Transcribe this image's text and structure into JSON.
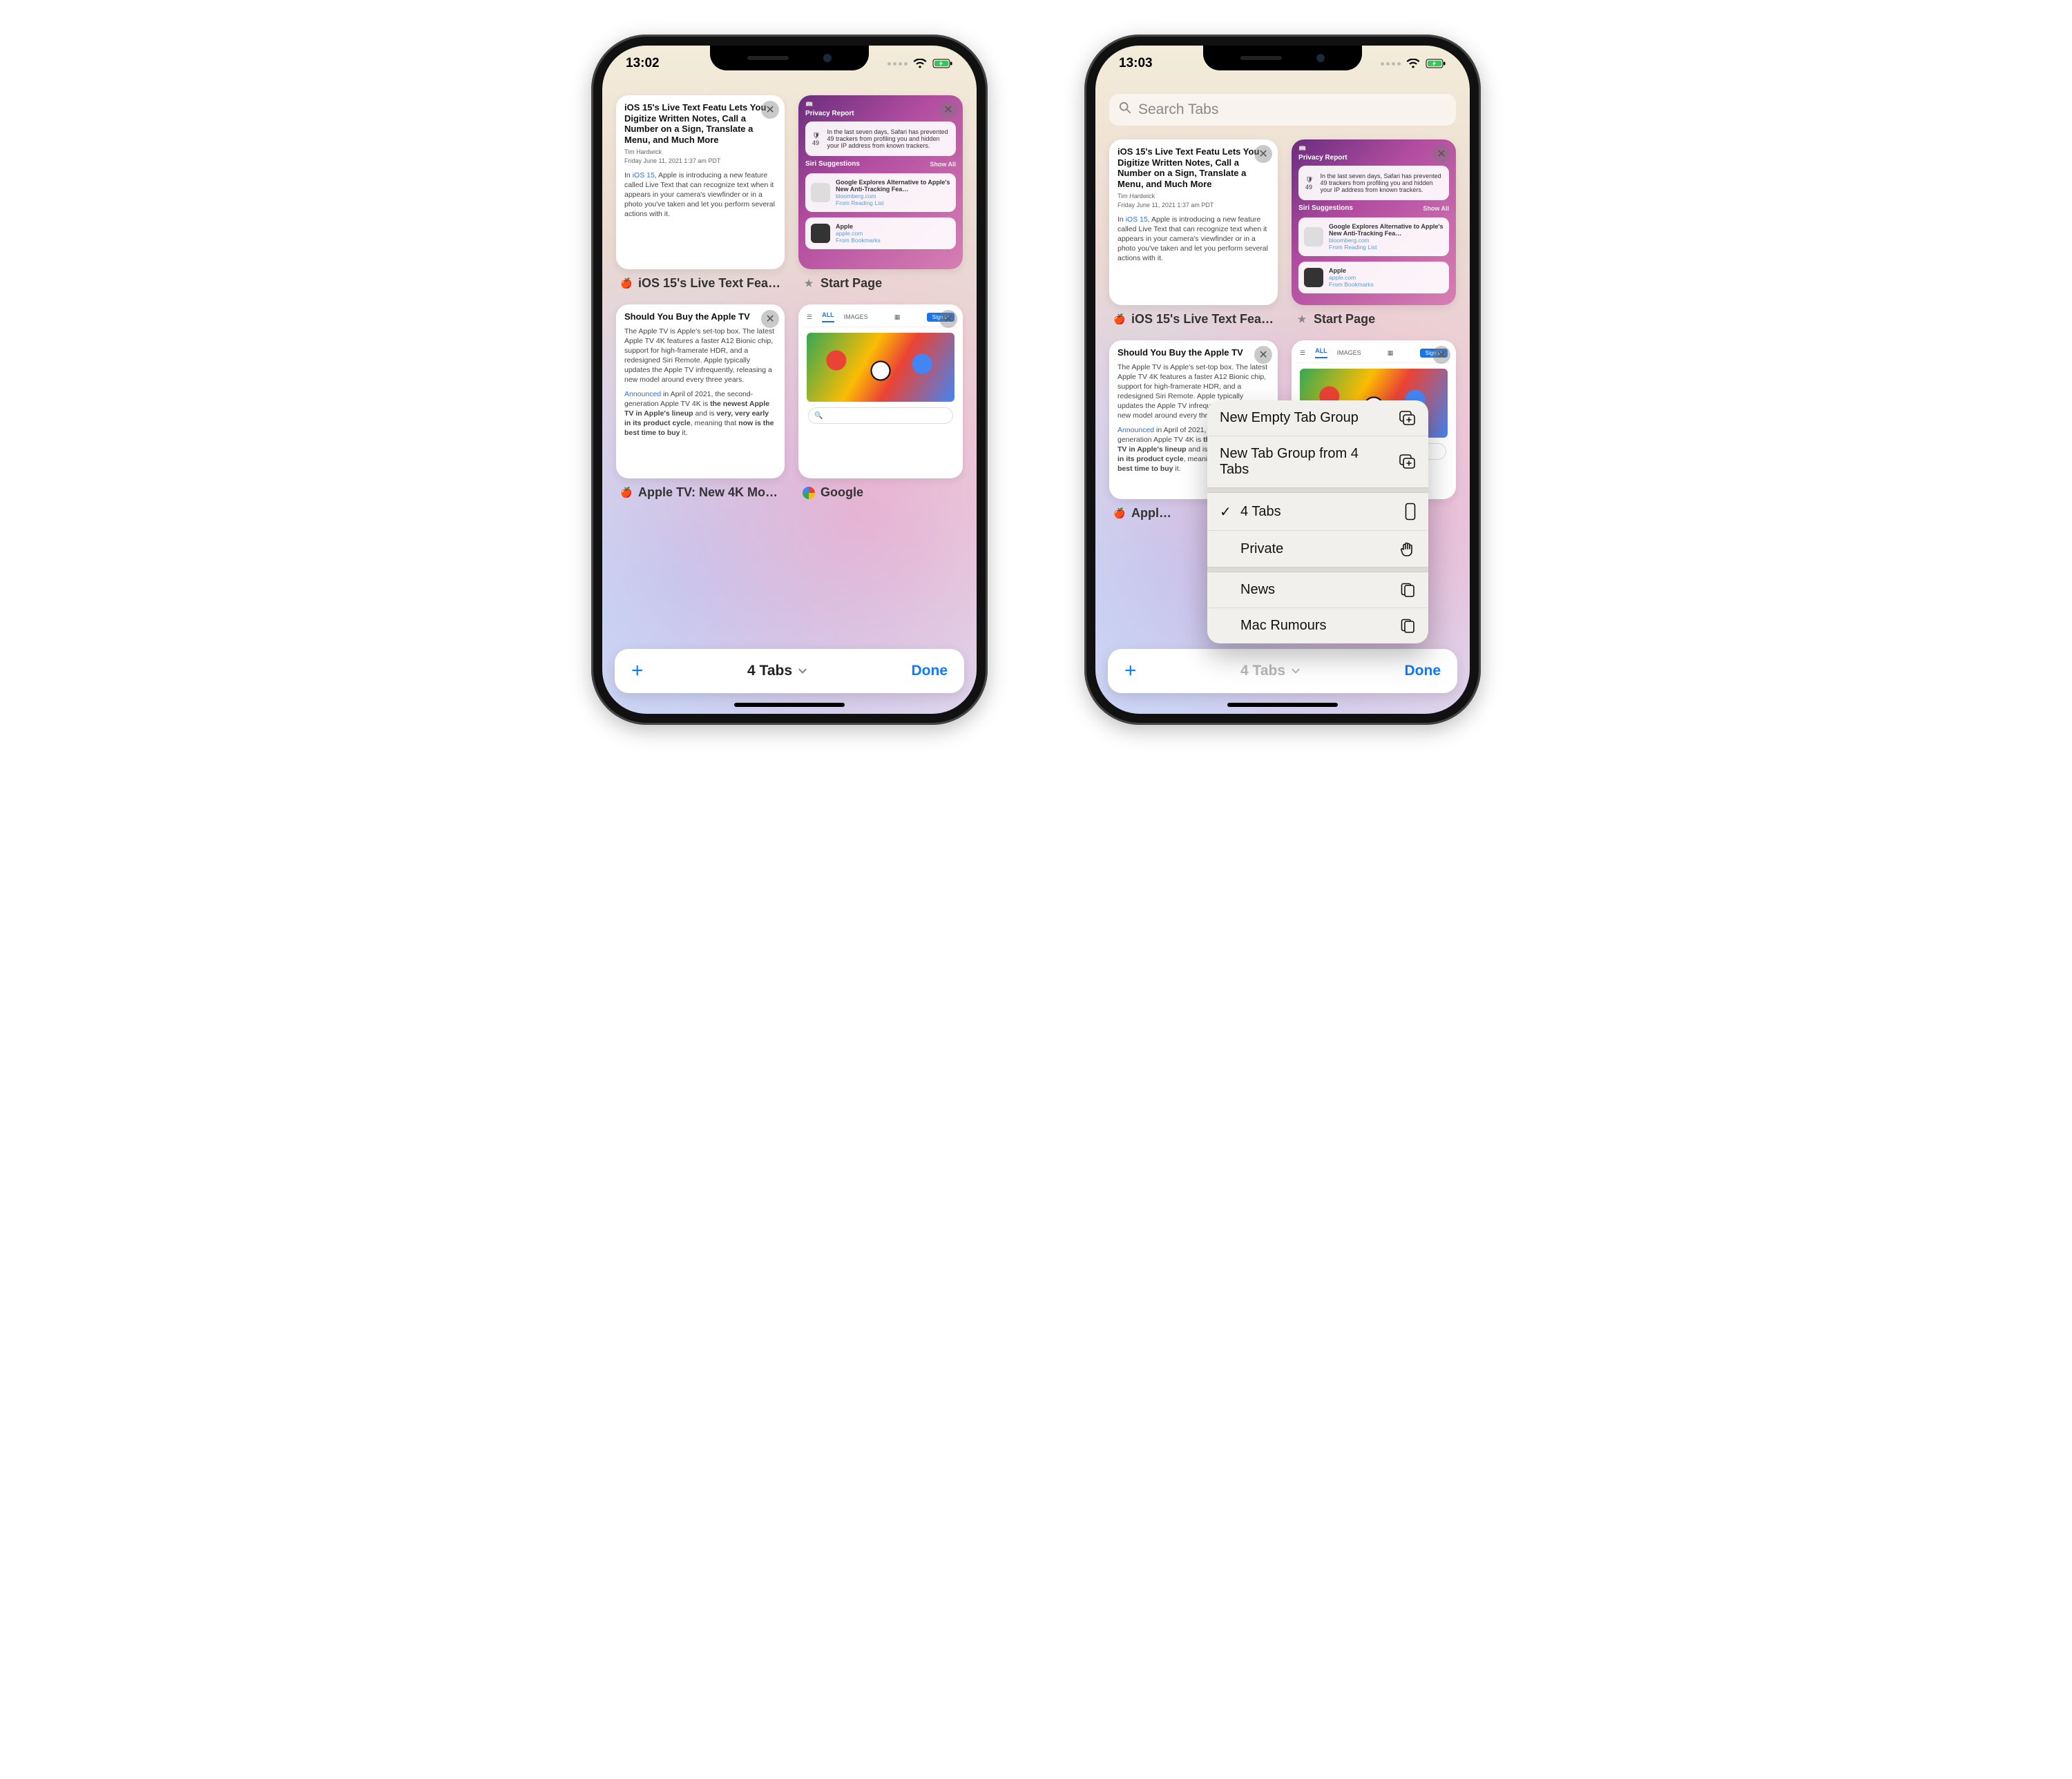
{
  "left": {
    "status": {
      "time": "13:02"
    },
    "tabs": [
      {
        "favicon": "🍎",
        "label": "iOS 15's Live Text Fea…",
        "article": {
          "title": "iOS 15's Live Text Featu Lets You Digitize Written Notes, Call a Number on a Sign, Translate a Menu, and Much More",
          "byline1": "Tim Hardwick",
          "byline2": "Friday June 11, 2021 1:37 am PDT",
          "body_pre": "In ",
          "body_link": "iOS 15",
          "body_post": ", Apple is introducing a new feature called Live Text that can recognize text when it appears in your camera's viewfinder or in a photo you've taken and let you perform several actions with it."
        }
      },
      {
        "favicon": "★",
        "label": "Start Page",
        "startpage": {
          "privacy_title": "Privacy Report",
          "shield_count": "49",
          "privacy_body": "In the last seven days, Safari has prevented 49 trackers from profiling you and hidden your IP address from known trackers.",
          "siri_title": "Siri Suggestions",
          "show_all": "Show All",
          "sug1_title": "Google Explores Alternative to Apple's New Anti-Tracking Fea…",
          "sug1_domain": "bloomberg.com",
          "sug1_src": "From Reading List",
          "sug2_title": "Apple",
          "sug2_domain": "apple.com",
          "sug2_src": "From Bookmarks"
        }
      },
      {
        "favicon": "🍎",
        "label": "Apple TV: New 4K Mo…",
        "article": {
          "title": "Should You Buy the Apple TV",
          "p1": "The Apple TV is Apple's set-top box. The latest Apple TV 4K features a faster A12 Bionic chip, support for high-framerate HDR, and a redesigned Siri Remote. Apple typically updates the Apple TV infrequently, releasing a new model around every three years.",
          "p2_pre": "Announced",
          "p2_mid": " in April of 2021, the second-generation Apple TV 4K is ",
          "p2_b1": "the newest Apple TV in Apple's lineup",
          "p2_mid2": " and is ",
          "p2_b2": "very, very early in its product cycle",
          "p2_mid3": ", meaning that ",
          "p2_b3": "now is the best time to buy",
          "p2_end": " it."
        }
      },
      {
        "favicon": "G",
        "label": "Google",
        "google": {
          "all": "ALL",
          "images": "IMAGES",
          "signin": "Sign in"
        }
      }
    ],
    "bottom": {
      "mid": "4 Tabs",
      "done": "Done"
    }
  },
  "right": {
    "status": {
      "time": "13:03"
    },
    "search_placeholder": "Search Tabs",
    "bottom": {
      "mid": "4 Tabs",
      "done": "Done"
    },
    "menu": {
      "new_empty": "New Empty Tab Group",
      "new_from": "New Tab Group from 4 Tabs",
      "current": "4 Tabs",
      "private": "Private",
      "group1": "News",
      "group2": "Mac Rumours"
    }
  }
}
